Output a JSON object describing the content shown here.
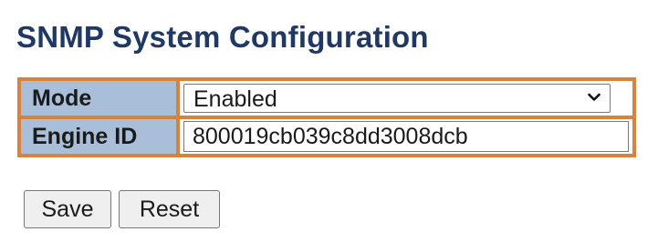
{
  "page": {
    "title": "SNMP System Configuration"
  },
  "config": {
    "mode": {
      "label": "Mode",
      "selected": "Enabled"
    },
    "engine_id": {
      "label": "Engine ID",
      "value": "800019cb039c8dd3008dcb"
    }
  },
  "buttons": {
    "save": "Save",
    "reset": "Reset"
  },
  "colors": {
    "title": "#1f3864",
    "label_bg": "#a9bfd9",
    "border": "#d9823a"
  },
  "icons": {
    "dropdown": "chevron-down-icon"
  }
}
